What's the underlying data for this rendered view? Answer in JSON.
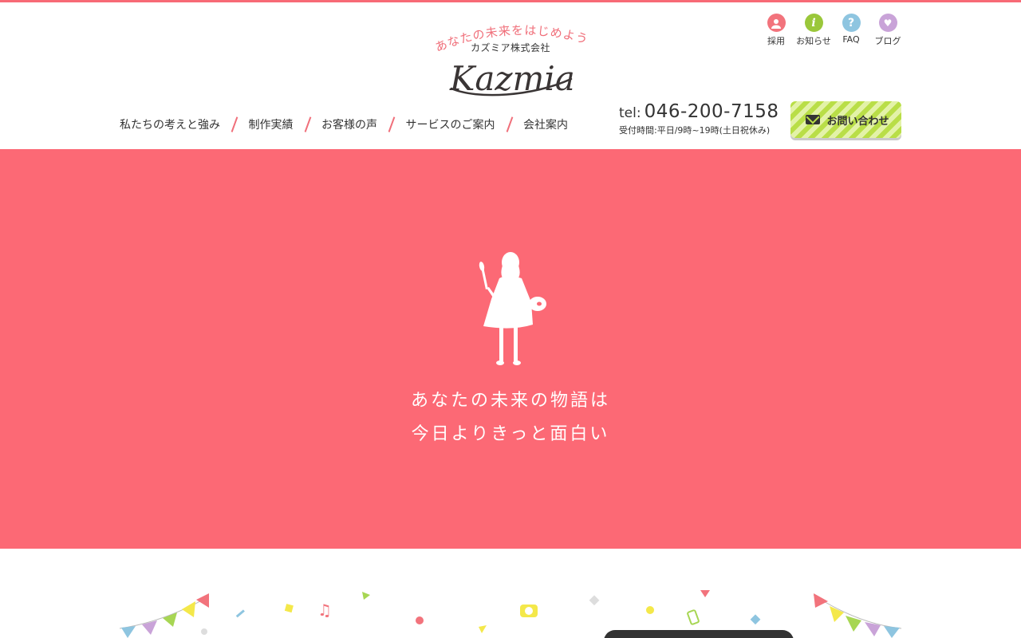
{
  "brand": {
    "tagline": "あなたの未来をはじめよう",
    "company_name": "カズミア株式会社",
    "wordmark": "Kazmia",
    "accent_color": "#fc6975"
  },
  "utility_nav": [
    {
      "label": "採用",
      "icon": "person-icon",
      "color": "#f2737c",
      "glyph": ""
    },
    {
      "label": "お知らせ",
      "icon": "info-icon",
      "color": "#9ac73a",
      "glyph": "i"
    },
    {
      "label": "FAQ",
      "icon": "question-icon",
      "color": "#8ec5e0",
      "glyph": "?"
    },
    {
      "label": "ブログ",
      "icon": "heart-icon",
      "color": "#c9a3d8",
      "glyph": "♥"
    }
  ],
  "main_nav": [
    {
      "label": "私たちの考えと強み"
    },
    {
      "label": "制作実績"
    },
    {
      "label": "お客様の声"
    },
    {
      "label": "サービスのご案内"
    },
    {
      "label": "会社案内"
    }
  ],
  "contact": {
    "tel_prefix": "tel:",
    "tel_number": "046-200-7158",
    "hours": "受付時間:平日/9時~19時(土日祝休み)",
    "button_label": "お問い合わせ",
    "button_icon": "mail-icon"
  },
  "hero": {
    "line1": "あなたの未来の物語は",
    "line2": "今日よりきっと面白い",
    "illustration": "girl-with-palette-silhouette",
    "background_color": "#fc6975"
  },
  "decoration": {
    "bunting_colors": [
      "#f2737c",
      "#f4e84a",
      "#a7d653",
      "#c9a3d8",
      "#8ec5e0"
    ]
  }
}
